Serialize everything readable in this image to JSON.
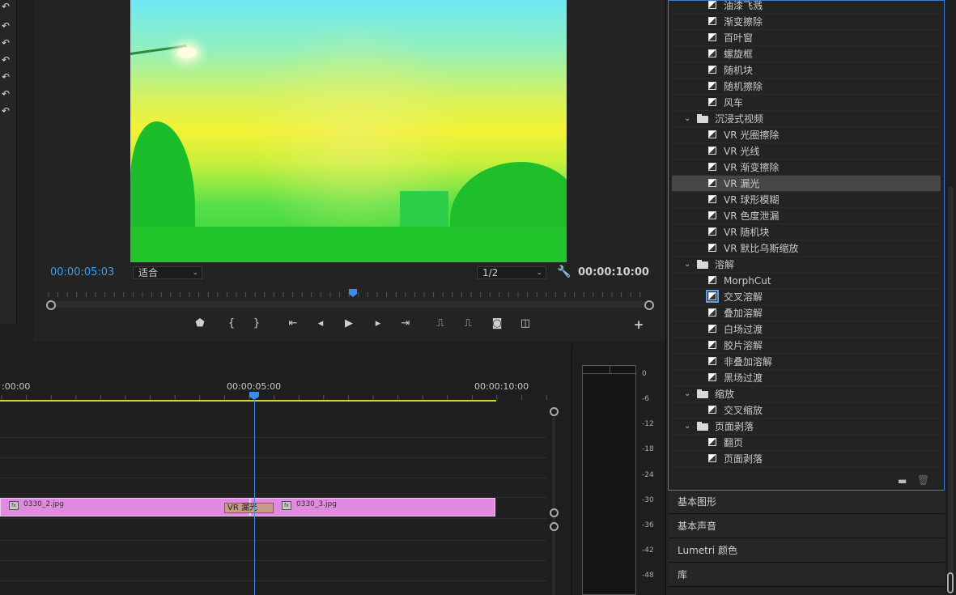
{
  "monitor": {
    "current_timecode": "00:00:05:03",
    "duration_timecode": "00:00:10:00",
    "fit_select": "适合",
    "resolution_select": "1/2"
  },
  "timeline": {
    "ruler_labels": [
      ":00:00",
      "00:00:05:00",
      "00:00:10:00"
    ],
    "clips": [
      {
        "name": "0330_2.jpg"
      },
      {
        "name": "0330_3.jpg"
      }
    ],
    "transition_label": "VR 漏光"
  },
  "meter": {
    "db_labels": [
      "0",
      "-6",
      "-12",
      "-18",
      "-24",
      "-30",
      "-36",
      "-42",
      "-48"
    ]
  },
  "effects": {
    "items": [
      {
        "type": "effect",
        "label": "油漆飞溅"
      },
      {
        "type": "effect",
        "label": "渐变擦除"
      },
      {
        "type": "effect",
        "label": "百叶窗"
      },
      {
        "type": "effect",
        "label": "螺旋框"
      },
      {
        "type": "effect",
        "label": "随机块"
      },
      {
        "type": "effect",
        "label": "随机擦除"
      },
      {
        "type": "effect",
        "label": "风车"
      },
      {
        "type": "folder",
        "label": "沉浸式视频"
      },
      {
        "type": "effect",
        "label": "VR 光圈擦除"
      },
      {
        "type": "effect",
        "label": "VR 光线"
      },
      {
        "type": "effect",
        "label": "VR 渐变擦除"
      },
      {
        "type": "effect",
        "label": "VR 漏光",
        "selected": true
      },
      {
        "type": "effect",
        "label": "VR 球形模糊"
      },
      {
        "type": "effect",
        "label": "VR 色度泄漏"
      },
      {
        "type": "effect",
        "label": "VR 随机块"
      },
      {
        "type": "effect",
        "label": "VR 默比乌斯缩放"
      },
      {
        "type": "folder",
        "label": "溶解"
      },
      {
        "type": "effect",
        "label": "MorphCut"
      },
      {
        "type": "effect",
        "label": "交叉溶解",
        "highlighted": true
      },
      {
        "type": "effect",
        "label": "叠加溶解"
      },
      {
        "type": "effect",
        "label": "白场过渡"
      },
      {
        "type": "effect",
        "label": "胶片溶解"
      },
      {
        "type": "effect",
        "label": "非叠加溶解"
      },
      {
        "type": "effect",
        "label": "黑场过渡"
      },
      {
        "type": "folder",
        "label": "缩放"
      },
      {
        "type": "effect",
        "label": "交叉缩放"
      },
      {
        "type": "folder",
        "label": "页面剥落"
      },
      {
        "type": "effect",
        "label": "翻页"
      },
      {
        "type": "effect",
        "label": "页面剥落"
      }
    ],
    "categories": [
      "基本图形",
      "基本声音",
      "Lumetri 颜色",
      "库"
    ]
  },
  "colors": {
    "accent_blue": "#3d8be8",
    "clip_pink": "#e08ae0",
    "timeline_yellow": "#d6d436"
  }
}
